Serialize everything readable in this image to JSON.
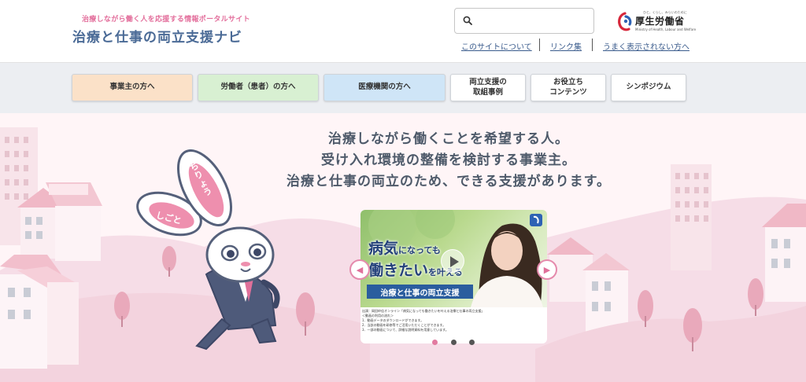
{
  "header": {
    "tagline": "治療しながら働く人を応援する情報ポータルサイト",
    "site_title": "治療と仕事の両立支援ナビ",
    "search_placeholder": "",
    "ministry": {
      "small_text": "ひと、くらし、みらいのために",
      "name": "厚生労働省",
      "english": "Ministry of Health, Labour and Welfare"
    },
    "links": [
      {
        "label": "このサイトについて"
      },
      {
        "label": "リンク集"
      },
      {
        "label": "うまく表示されない方へ"
      }
    ]
  },
  "nav": [
    {
      "label": "事業主の方へ",
      "color": "#fbe1c8"
    },
    {
      "label": "労働者（患者）の方へ",
      "color": "#d8f0d2"
    },
    {
      "label": "医療機関の方へ",
      "color": "#cfe5f7"
    },
    {
      "label": "両立支援の\n取組事例",
      "color": "#ffffff"
    },
    {
      "label": "お役立ち\nコンテンツ",
      "color": "#ffffff"
    },
    {
      "label": "シンポジウム",
      "color": "#ffffff"
    }
  ],
  "hero": {
    "lines": [
      "治療しながら働くことを希望する人。",
      "受け入れ環境の整備を検討する事業主。",
      "治療と仕事の両立のため、できる支援があります。"
    ],
    "mascot": {
      "ear_left": "しごと",
      "ear_right": "ちりょう"
    },
    "slide": {
      "text_big1": "病気",
      "text_small1": "になっても",
      "text_big2": "働きたい",
      "text_small2": "を叶える",
      "band": "治療と仕事の両立支援",
      "caption_lines": [
        "出演：岡田紗佳オンライン「病気になっても働きたいを叶える治療と仕事の両立支援」",
        "＜動画の利用の流れ＞",
        "1．動画データのダウンロードができます。",
        "2．当該の動画を研修等でご活用いただくことができます。",
        "3．一部の動画について、詳細な説明資料を用意しています。"
      ]
    },
    "prev_label": "◀",
    "next_label": "▶",
    "dots": [
      {
        "active": true,
        "color": "#e27aa0"
      },
      {
        "active": false,
        "color": "#555555"
      },
      {
        "active": false,
        "color": "#555555"
      }
    ]
  }
}
